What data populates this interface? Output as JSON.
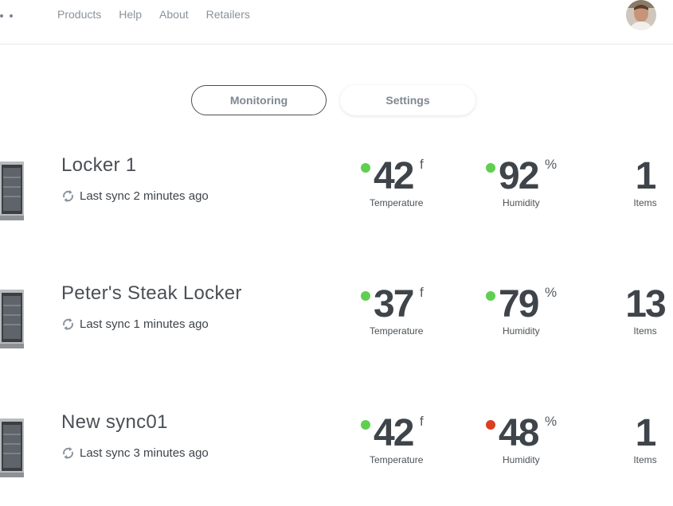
{
  "nav": {
    "items": [
      "Products",
      "Help",
      "About",
      "Retailers"
    ]
  },
  "tabs": {
    "monitoring_label": "Monitoring",
    "settings_label": "Settings"
  },
  "lockers": [
    {
      "name": "Locker 1",
      "sync": "Last sync 2 minutes ago",
      "temperature": {
        "value": "42",
        "unit": "f",
        "label": "Temperature",
        "status": "ok"
      },
      "humidity": {
        "value": "92",
        "unit": "%",
        "label": "Humidity",
        "status": "ok"
      },
      "items": {
        "value": "1",
        "label": "Items"
      }
    },
    {
      "name": "Peter's Steak Locker",
      "sync": "Last sync 1 minutes ago",
      "temperature": {
        "value": "37",
        "unit": "f",
        "label": "Temperature",
        "status": "ok"
      },
      "humidity": {
        "value": "79",
        "unit": "%",
        "label": "Humidity",
        "status": "ok"
      },
      "items": {
        "value": "13",
        "label": "Items"
      }
    },
    {
      "name": "New sync01",
      "sync": "Last sync 3 minutes ago",
      "temperature": {
        "value": "42",
        "unit": "f",
        "label": "Temperature",
        "status": "ok"
      },
      "humidity": {
        "value": "48",
        "unit": "%",
        "label": "Humidity",
        "status": "alert"
      },
      "items": {
        "value": "1",
        "label": "Items"
      }
    }
  ],
  "colors": {
    "status_ok": "#5fcf4f",
    "status_alert": "#d9401f",
    "text_dark": "#3e444a",
    "nav_text": "#8a929b"
  },
  "icons": {
    "sync": "sync-icon",
    "avatar": "user-avatar",
    "logo": "logo-dots"
  }
}
